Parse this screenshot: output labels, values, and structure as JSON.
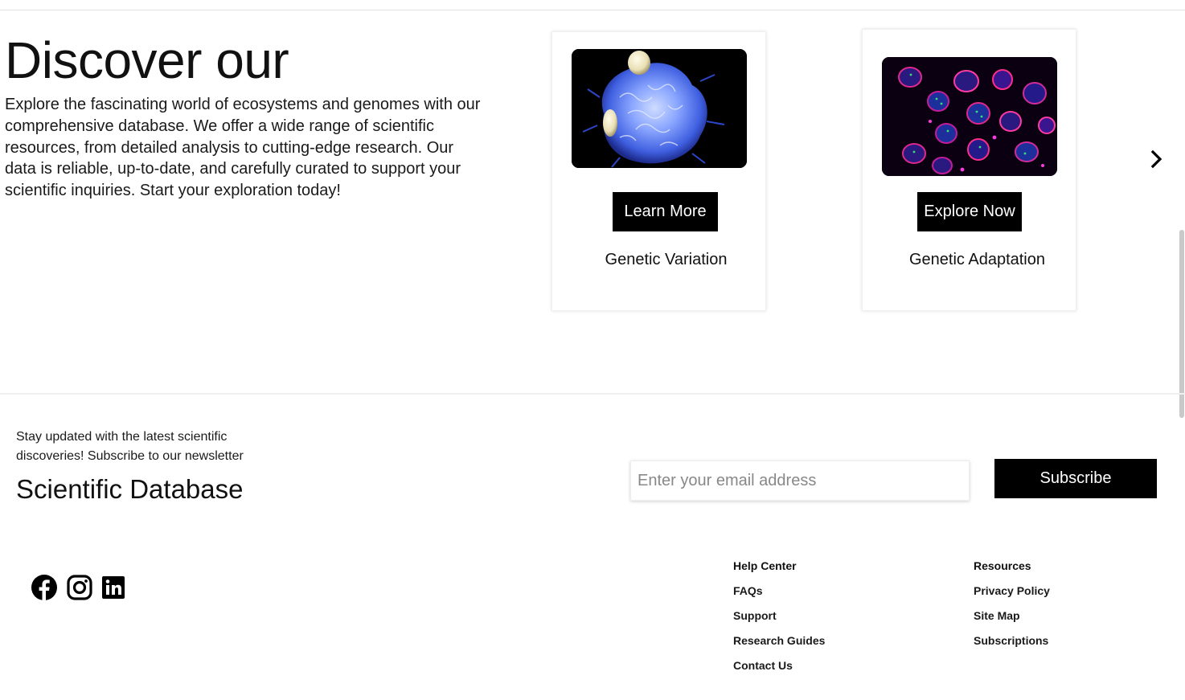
{
  "hero": {
    "title": "Discover our",
    "description": "Explore the fascinating world of ecosystems and genomes with our comprehensive database. We offer a wide range of scientific resources, from detailed analysis to cutting-edge research. Our data is reliable, up-to-date, and carefully curated to support your scientific inquiries. Start your exploration today!"
  },
  "cards": [
    {
      "button_label": "Learn More",
      "caption": "Genetic Variation",
      "image": "blue-cell-micrograph"
    },
    {
      "button_label": "Explore Now",
      "caption": "Genetic Adaptation",
      "image": "fluorescent-nuclei-micrograph"
    }
  ],
  "carousel": {
    "next_icon": "chevron-right-icon"
  },
  "newsletter": {
    "text": "Stay updated with the latest scientific discoveries! Subscribe to our newsletter",
    "brand": "Scientific Database",
    "email_placeholder": "Enter your email address",
    "email_value": "",
    "subscribe_label": "Subscribe"
  },
  "social": [
    {
      "icon": "facebook-icon"
    },
    {
      "icon": "instagram-icon"
    },
    {
      "icon": "linkedin-icon"
    }
  ],
  "footer": {
    "columns": [
      {
        "heading": "Help Center",
        "links": [
          "FAQs",
          "Support",
          "Research Guides",
          "Contact Us"
        ]
      },
      {
        "heading": "Resources",
        "links": [
          "Privacy Policy",
          "Site Map",
          "Subscriptions"
        ]
      }
    ]
  },
  "colors": {
    "button_bg": "#000000",
    "button_text": "#ffffff",
    "text": "#111111"
  }
}
